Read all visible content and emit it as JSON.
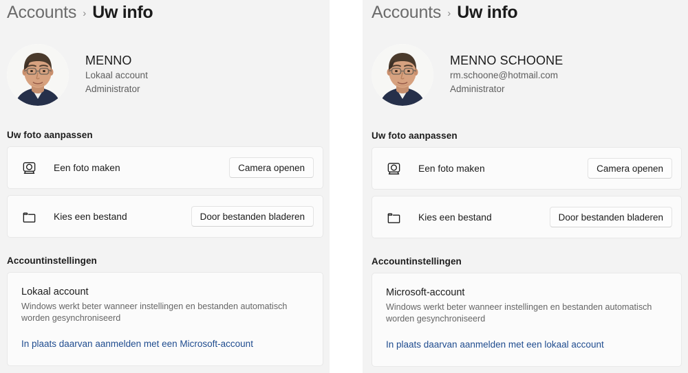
{
  "theme": {
    "panel_bg": "#f3f3f3",
    "card_bg": "#fbfbfb",
    "card_border": "#e8e8e8",
    "text_primary": "#1b1b1b",
    "text_secondary": "#5e5e5e",
    "link_color": "#1f4c8f",
    "button_bg": "#fdfdfd"
  },
  "panels": [
    {
      "id": "local-account-panel",
      "breadcrumb": {
        "root": "Accounts",
        "separator": "›",
        "current": "Uw info"
      },
      "identity": {
        "name": "MENNO",
        "line2": "Lokaal account",
        "line3": "Administrator",
        "avatar_icon": "user-avatar-photo"
      },
      "photo_section": {
        "title": "Uw foto aanpassen",
        "rows": [
          {
            "icon": "camera-icon",
            "label": "Een foto maken",
            "button": "Camera openen"
          },
          {
            "icon": "folder-icon",
            "label": "Kies een bestand",
            "button": "Door bestanden bladeren"
          }
        ]
      },
      "account_section": {
        "title": "Accountinstellingen",
        "account_type": "Lokaal account",
        "description": "Windows werkt beter wanneer instellingen en bestanden automatisch worden gesynchroniseerd",
        "link": "In plaats daarvan aanmelden met een Microsoft-account"
      }
    },
    {
      "id": "microsoft-account-panel",
      "breadcrumb": {
        "root": "Accounts",
        "separator": "›",
        "current": "Uw info"
      },
      "identity": {
        "name": "MENNO SCHOONE",
        "line2": "rm.schoone@hotmail.com",
        "line3": "Administrator",
        "avatar_icon": "user-avatar-photo"
      },
      "photo_section": {
        "title": "Uw foto aanpassen",
        "rows": [
          {
            "icon": "camera-icon",
            "label": "Een foto maken",
            "button": "Camera openen"
          },
          {
            "icon": "folder-icon",
            "label": "Kies een bestand",
            "button": "Door bestanden bladeren"
          }
        ]
      },
      "account_section": {
        "title": "Accountinstellingen",
        "account_type": "Microsoft-account",
        "description": "Windows werkt beter wanneer instellingen en bestanden automatisch worden gesynchroniseerd",
        "link": "In plaats daarvan aanmelden met een lokaal account"
      }
    }
  ]
}
